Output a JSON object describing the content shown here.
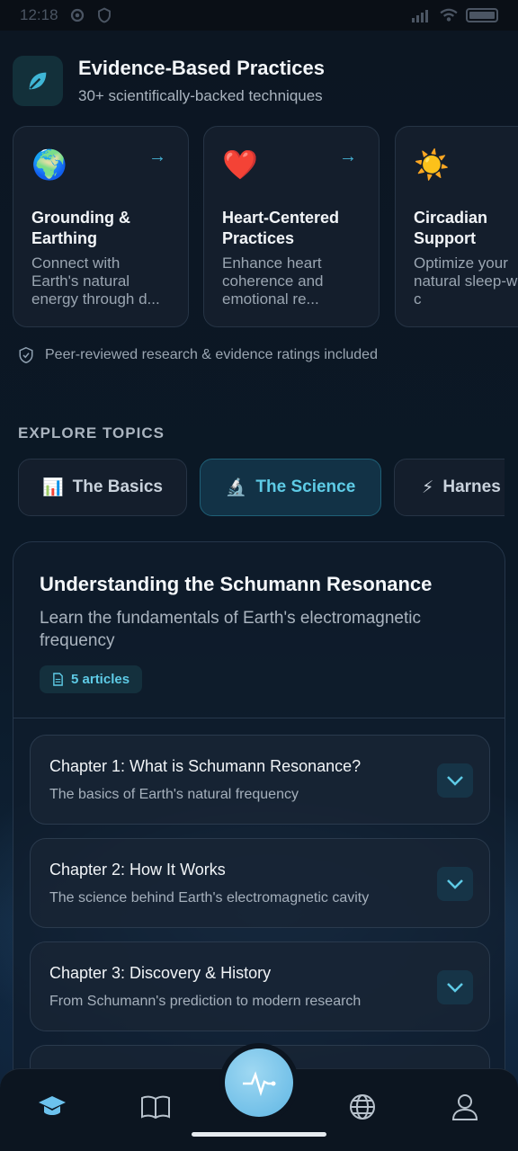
{
  "status_bar": {
    "time": "12:18"
  },
  "header": {
    "title": "Evidence-Based Practices",
    "subtitle": "30+ scientifically-backed techniques",
    "icon": "leaf-icon"
  },
  "practice_cards": [
    {
      "emoji": "🌍",
      "title": "Grounding & Earthing",
      "description": "Connect with Earth's natural energy through d..."
    },
    {
      "emoji": "❤️",
      "title": "Heart-Centered Practices",
      "description": "Enhance heart coherence and emotional re..."
    },
    {
      "emoji": "☀️",
      "title": "Circadian Support",
      "description": "Optimize your natural sleep-wake c"
    }
  ],
  "peer_note": "Peer-reviewed research & evidence ratings included",
  "explore_label": "EXPLORE TOPICS",
  "topic_tabs": [
    {
      "emoji": "📊",
      "label": "The Basics"
    },
    {
      "emoji": "🔬",
      "label": "The Science"
    },
    {
      "emoji": "⚡",
      "label": "Harnes"
    }
  ],
  "active_tab": "The Science",
  "topic": {
    "title": "Understanding the Schumann Resonance",
    "subtitle": "Learn the fundamentals of Earth's electromagnetic frequency",
    "badge": "5 articles"
  },
  "chapters": [
    {
      "title": "Chapter 1: What is Schumann Resonance?",
      "subtitle": "The basics of Earth's natural frequency"
    },
    {
      "title": "Chapter 2: How It Works",
      "subtitle": "The science behind Earth's electromagnetic cavity"
    },
    {
      "title": "Chapter 3: Discovery & History",
      "subtitle": "From Schumann's prediction to modern research"
    }
  ],
  "bottom_nav": [
    "learn-icon",
    "book-icon",
    "pulse-icon",
    "globe-icon",
    "profile-icon"
  ],
  "colors": {
    "accent": "#5ecbe6",
    "active_nav": "#6cc2ee"
  }
}
